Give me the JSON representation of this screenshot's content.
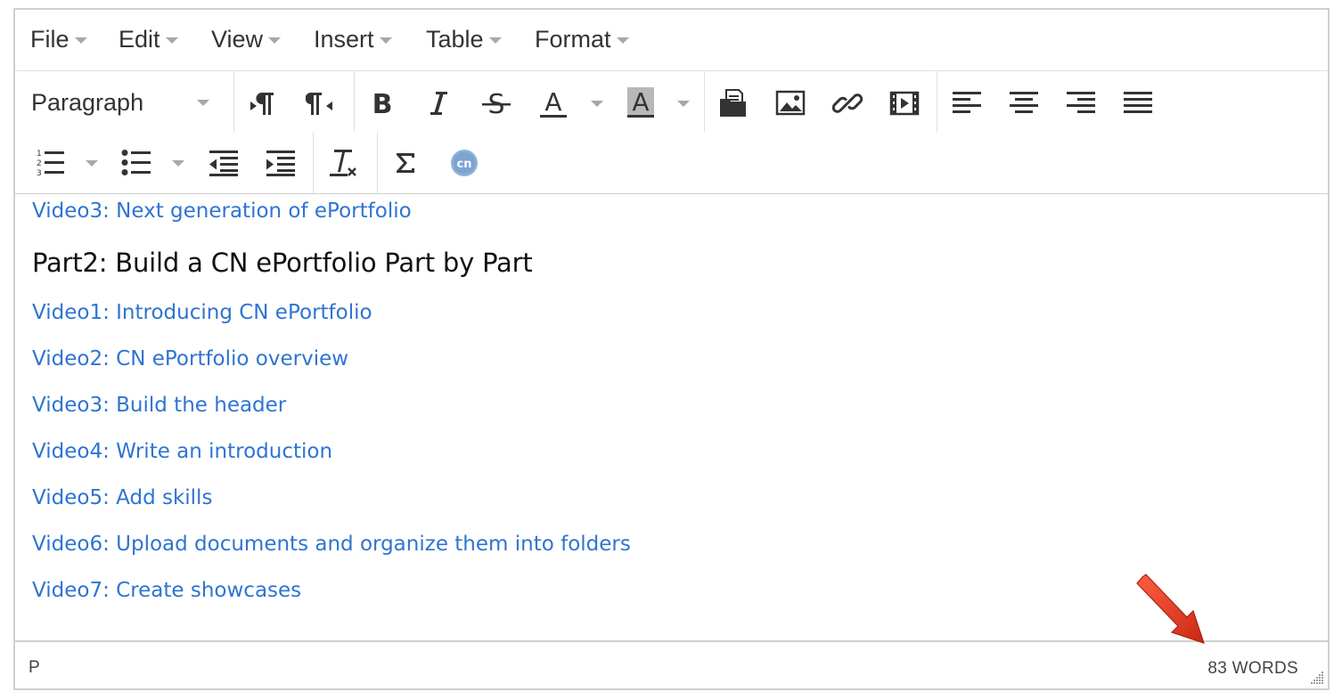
{
  "menubar": {
    "items": [
      {
        "label": "File"
      },
      {
        "label": "Edit"
      },
      {
        "label": "View"
      },
      {
        "label": "Insert"
      },
      {
        "label": "Table"
      },
      {
        "label": "Format"
      }
    ]
  },
  "toolbar": {
    "block_format": "Paragraph",
    "buttons": [
      "ltr-icon",
      "rtl-icon",
      "bold-icon",
      "italic-icon",
      "strikethrough-icon",
      "text-color-icon",
      "background-color-icon",
      "file-manager-icon",
      "image-icon",
      "link-icon",
      "media-icon",
      "align-left-icon",
      "align-center-icon",
      "align-right-icon",
      "align-justify-icon",
      "numbered-list-icon",
      "bullet-list-icon",
      "outdent-icon",
      "indent-icon",
      "clear-formatting-icon",
      "sigma-icon",
      "cn-icon"
    ],
    "text_color_glyph": "A",
    "background_color_glyph": "A",
    "cn_badge": "cn"
  },
  "content": {
    "top_link": "Video3: Next generation of ePortfolio",
    "heading": "Part2: Build a CN ePortfolio Part by Part",
    "links": [
      "Video1: Introducing CN ePortfolio",
      "Video2: CN ePortfolio overview",
      "Video3: Build the header",
      "Video4: Write an introduction",
      "Video5: Add skills",
      "Video6: Upload documents and organize them into folders",
      "Video7: Create showcases"
    ]
  },
  "statusbar": {
    "path": "P",
    "word_count": "83 WORDS"
  },
  "colors": {
    "link": "#2e74d2",
    "arrow": "#e23a1e",
    "icon": "#333333"
  }
}
